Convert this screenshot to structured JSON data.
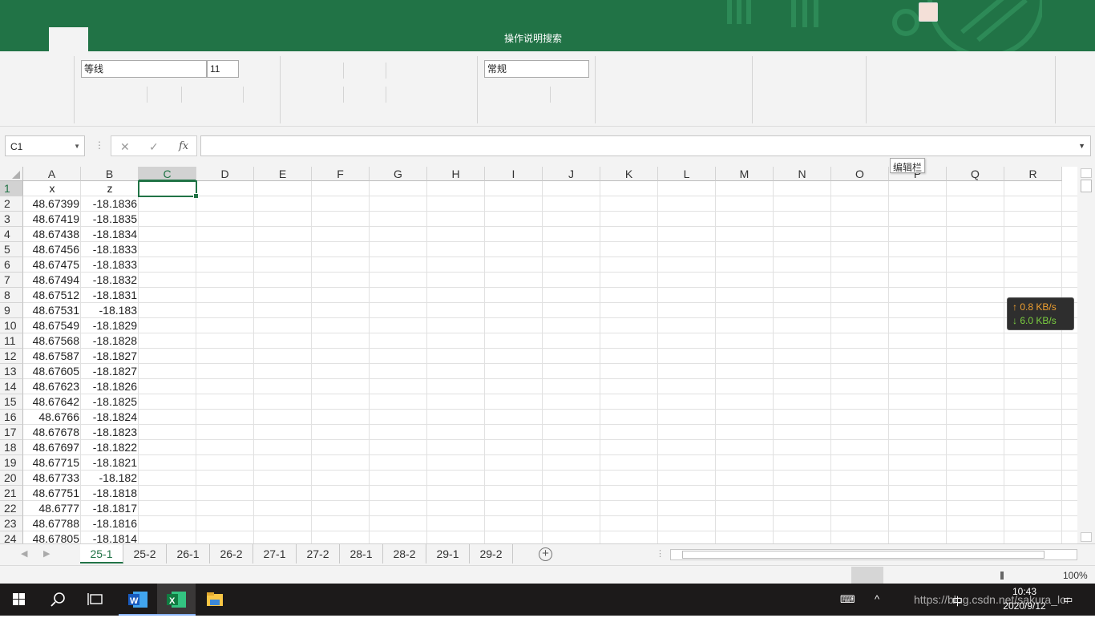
{
  "ribbon": {
    "search_label": "操作说明搜索",
    "font_name": "等线",
    "font_size": "11",
    "number_format": "常规"
  },
  "formula_bar": {
    "name_box": "C1",
    "cancel_symbol": "✕",
    "enter_symbol": "✓",
    "fx_symbol": "fx",
    "formula_value": "",
    "tooltip": "编辑栏"
  },
  "columns": [
    "A",
    "B",
    "C",
    "D",
    "E",
    "F",
    "G",
    "H",
    "I",
    "J",
    "K",
    "L",
    "M",
    "N",
    "O",
    "P",
    "Q",
    "R"
  ],
  "selected_column": "C",
  "rows": [
    {
      "n": "1",
      "a": "x",
      "b": "z"
    },
    {
      "n": "2",
      "a": "48.67399",
      "b": "-18.1836"
    },
    {
      "n": "3",
      "a": "48.67419",
      "b": "-18.1835"
    },
    {
      "n": "4",
      "a": "48.67438",
      "b": "-18.1834"
    },
    {
      "n": "5",
      "a": "48.67456",
      "b": "-18.1833"
    },
    {
      "n": "6",
      "a": "48.67475",
      "b": "-18.1833"
    },
    {
      "n": "7",
      "a": "48.67494",
      "b": "-18.1832"
    },
    {
      "n": "8",
      "a": "48.67512",
      "b": "-18.1831"
    },
    {
      "n": "9",
      "a": "48.67531",
      "b": "-18.183"
    },
    {
      "n": "10",
      "a": "48.67549",
      "b": "-18.1829"
    },
    {
      "n": "11",
      "a": "48.67568",
      "b": "-18.1828"
    },
    {
      "n": "12",
      "a": "48.67587",
      "b": "-18.1827"
    },
    {
      "n": "13",
      "a": "48.67605",
      "b": "-18.1827"
    },
    {
      "n": "14",
      "a": "48.67623",
      "b": "-18.1826"
    },
    {
      "n": "15",
      "a": "48.67642",
      "b": "-18.1825"
    },
    {
      "n": "16",
      "a": "48.6766",
      "b": "-18.1824"
    },
    {
      "n": "17",
      "a": "48.67678",
      "b": "-18.1823"
    },
    {
      "n": "18",
      "a": "48.67697",
      "b": "-18.1822"
    },
    {
      "n": "19",
      "a": "48.67715",
      "b": "-18.1821"
    },
    {
      "n": "20",
      "a": "48.67733",
      "b": "-18.182"
    },
    {
      "n": "21",
      "a": "48.67751",
      "b": "-18.1818"
    },
    {
      "n": "22",
      "a": "48.6777",
      "b": "-18.1817"
    },
    {
      "n": "23",
      "a": "48.67788",
      "b": "-18.1816"
    },
    {
      "n": "24",
      "a": "48.67805",
      "b": "-18.1814"
    }
  ],
  "network": {
    "up": "↑ 0.8 KB/s",
    "down": "↓ 6.0 KB/s"
  },
  "sheet_tabs": [
    "25-1",
    "25-2",
    "26-1",
    "26-2",
    "27-1",
    "27-2",
    "28-1",
    "28-2",
    "29-1",
    "29-2"
  ],
  "active_sheet": "25-1",
  "status": {
    "zoom": "100%"
  },
  "taskbar": {
    "time": "10:43",
    "date": "2020/9/12",
    "watermark": "https://blog.csdn.net/sakura_lor",
    "ime": "中"
  },
  "colors": {
    "excel_green": "#217346",
    "taskbar_bg": "#1c1a1a"
  }
}
